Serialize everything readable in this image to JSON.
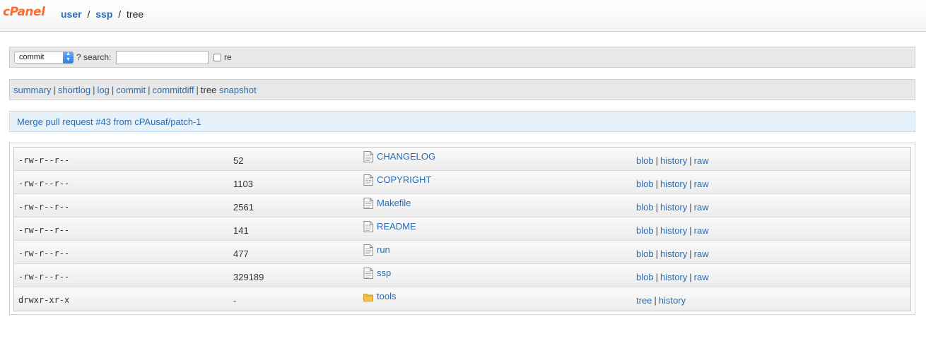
{
  "header": {
    "logo": "cPanel",
    "breadcrumb": {
      "user": "user",
      "repo": "ssp",
      "current": "tree",
      "separator": "/"
    }
  },
  "search": {
    "select_value": "commit",
    "help": "?",
    "label": "search:",
    "input_value": "",
    "re_label": "re"
  },
  "nav": {
    "summary": "summary",
    "shortlog": "shortlog",
    "log": "log",
    "commit": "commit",
    "commitdiff": "commitdiff",
    "tree": "tree",
    "snapshot": "snapshot",
    "separator": "|"
  },
  "commit_title": "Merge pull request #43 from cPAusaf/patch-1",
  "tree": {
    "rows": [
      {
        "mode": "-rw-r--r--",
        "size": "52",
        "name": "CHANGELOG",
        "type": "file",
        "links": [
          "blob",
          "history",
          "raw"
        ]
      },
      {
        "mode": "-rw-r--r--",
        "size": "1103",
        "name": "COPYRIGHT",
        "type": "file",
        "links": [
          "blob",
          "history",
          "raw"
        ]
      },
      {
        "mode": "-rw-r--r--",
        "size": "2561",
        "name": "Makefile",
        "type": "file",
        "links": [
          "blob",
          "history",
          "raw"
        ]
      },
      {
        "mode": "-rw-r--r--",
        "size": "141",
        "name": "README",
        "type": "file",
        "links": [
          "blob",
          "history",
          "raw"
        ]
      },
      {
        "mode": "-rw-r--r--",
        "size": "477",
        "name": "run",
        "type": "file",
        "links": [
          "blob",
          "history",
          "raw"
        ]
      },
      {
        "mode": "-rw-r--r--",
        "size": "329189",
        "name": "ssp",
        "type": "file",
        "links": [
          "blob",
          "history",
          "raw"
        ]
      },
      {
        "mode": "drwxr-xr-x",
        "size": "-",
        "name": "tools",
        "type": "folder",
        "links": [
          "tree",
          "history"
        ]
      }
    ]
  },
  "colors": {
    "link": "#2a6db5",
    "brand": "#ff6c2c",
    "bar_bg": "#e8e8e8",
    "title_bg": "#e7f1f9"
  },
  "icons": {
    "file": "document-icon",
    "folder": "folder-icon"
  }
}
